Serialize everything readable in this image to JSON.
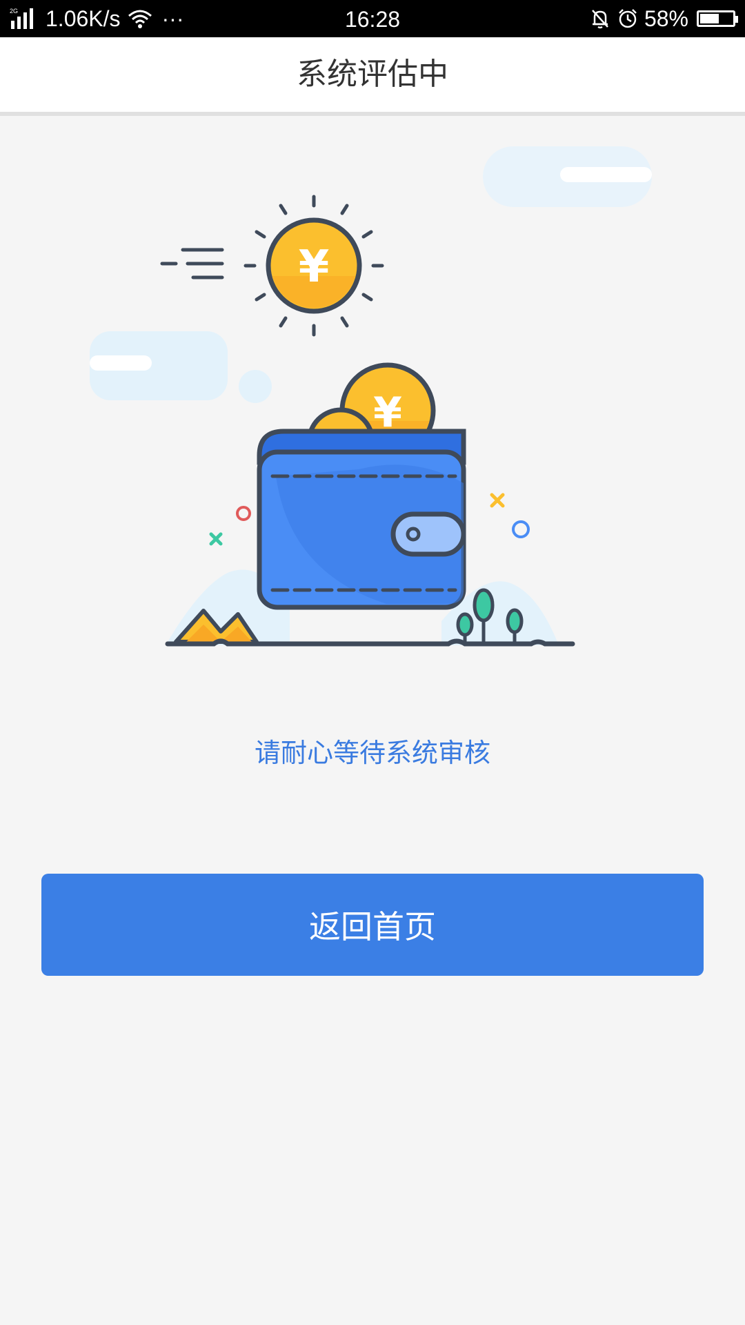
{
  "status_bar": {
    "network_type": "2G",
    "speed": "1.06K/s",
    "dots": "···",
    "time": "16:28",
    "battery_percent": "58%",
    "battery_level": 0.58,
    "icons": [
      "signal-icon",
      "wifi-icon",
      "mute-bell-icon",
      "alarm-icon",
      "battery-icon"
    ]
  },
  "header": {
    "title": "系统评估中"
  },
  "illustration": {
    "coin_symbol": "¥",
    "icons": [
      "sun-coin-icon",
      "wallet-icon",
      "coin-icon",
      "cloud-icon",
      "mountain-icon",
      "tree-icon"
    ]
  },
  "main": {
    "message": "请耐心等待系统审核"
  },
  "actions": {
    "home_label": "返回首页"
  },
  "colors": {
    "accent": "#3b7fe5",
    "message_text": "#3a7be0",
    "coin_gold": "#fbbf2e",
    "wallet_blue": "#4a8df5",
    "outline": "#3f4a5a"
  }
}
